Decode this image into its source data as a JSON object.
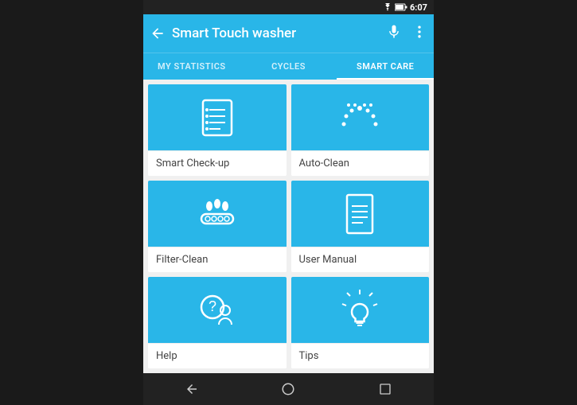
{
  "statusBar": {
    "time": "6:07",
    "wifiIcon": "wifi",
    "batteryIcon": "battery"
  },
  "appBar": {
    "title": "Smart Touch washer",
    "backIcon": "←",
    "micIcon": "mic",
    "moreIcon": "⋮"
  },
  "tabs": [
    {
      "label": "MY STATISTICS",
      "active": false
    },
    {
      "label": "CYCLES",
      "active": false
    },
    {
      "label": "SMART CARE",
      "active": true
    }
  ],
  "cards": [
    {
      "label": "Smart Check-up",
      "icon": "checklist"
    },
    {
      "label": "Auto-Clean",
      "icon": "dots"
    },
    {
      "label": "Filter-Clean",
      "icon": "filter"
    },
    {
      "label": "User Manual",
      "icon": "document"
    },
    {
      "label": "Help",
      "icon": "help"
    },
    {
      "label": "Tips",
      "icon": "bulb"
    }
  ],
  "navBar": {
    "back": "◁",
    "home": "○",
    "square": "□"
  }
}
